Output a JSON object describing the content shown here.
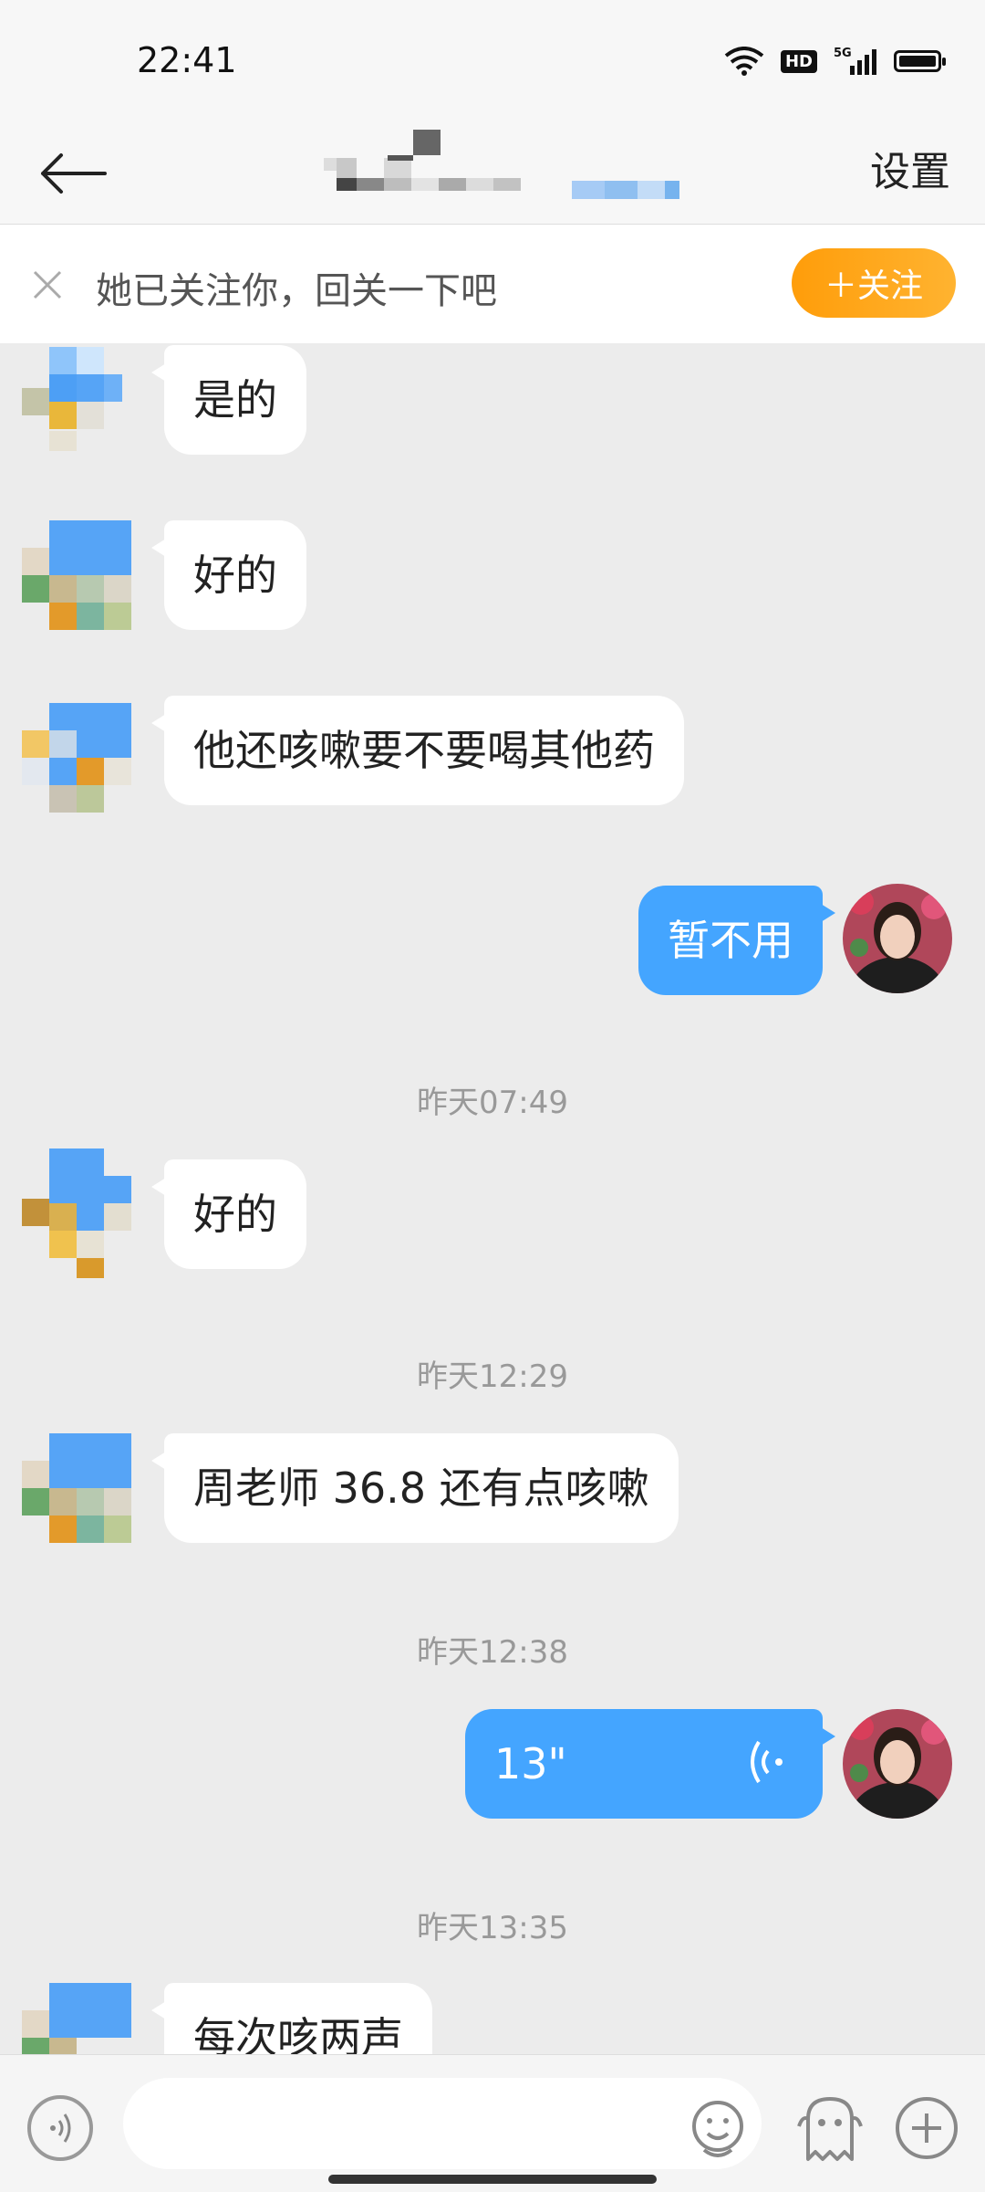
{
  "status_bar": {
    "time": "22:41",
    "hd": "HD",
    "network": "5G"
  },
  "header": {
    "settings_label": "设置"
  },
  "follow_banner": {
    "text": "她已关注你，回关一下吧",
    "button_label": "＋关注"
  },
  "messages": [
    {
      "side": "in",
      "text": "是的"
    },
    {
      "side": "in",
      "text": "好的"
    },
    {
      "side": "in",
      "text": "他还咳嗽要不要喝其他药"
    },
    {
      "side": "out",
      "text": "暂不用"
    },
    {
      "timestamp": "昨天07:49"
    },
    {
      "side": "in",
      "text": "好的"
    },
    {
      "timestamp": "昨天12:29"
    },
    {
      "side": "in",
      "text": "周老师  36.8  还有点咳嗽"
    },
    {
      "timestamp": "昨天12:38"
    },
    {
      "side": "out",
      "type": "voice",
      "duration": "13\""
    },
    {
      "timestamp": "昨天13:35"
    },
    {
      "side": "in",
      "text": "每次咳两声"
    }
  ],
  "input_bar": {
    "placeholder": ""
  },
  "colors": {
    "bubble_out": "#44a5ff",
    "follow_button": "#ffa11a",
    "background": "#ececec"
  }
}
